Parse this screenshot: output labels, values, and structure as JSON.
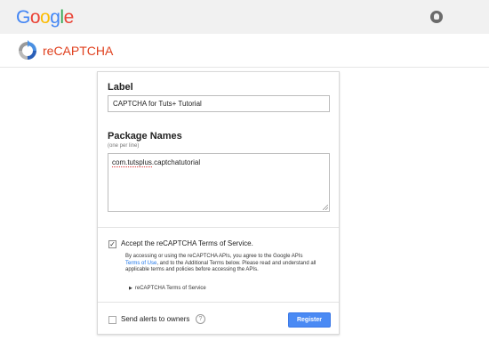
{
  "header": {
    "logo_letters": [
      {
        "ch": "G",
        "color": "#4285F4"
      },
      {
        "ch": "o",
        "color": "#EA4335"
      },
      {
        "ch": "o",
        "color": "#FBBC05"
      },
      {
        "ch": "g",
        "color": "#4285F4"
      },
      {
        "ch": "l",
        "color": "#34A853"
      },
      {
        "ch": "e",
        "color": "#EA4335"
      }
    ],
    "account_icon": "account-circle-icon"
  },
  "brand": {
    "title": "reCAPTCHA",
    "icon": "recaptcha-logo-icon",
    "accent_color": "#e0401e"
  },
  "form": {
    "label_heading": "Label",
    "label_value": "CAPTCHA for Tuts+ Tutorial",
    "package_heading": "Package Names",
    "package_hint": "(one per line)",
    "package_value_prefix": "com.tutsplus",
    "package_value_rest": ".captchatutorial",
    "tos": {
      "checked": true,
      "label": "Accept the reCAPTCHA Terms of Service.",
      "text_before": "By accessing or using the reCAPTCHA APIs, you agree to the Google APIs ",
      "link_text": "Terms of Use",
      "text_after": ", and to the Additional Terms below. Please read and understand all applicable terms and policies before accessing the APIs.",
      "expander_label": "reCAPTCHA Terms of Service"
    },
    "alerts": {
      "checked": false,
      "label": "Send alerts to owners",
      "help": "?"
    },
    "register_label": "Register",
    "register_color": "#4a8af4"
  }
}
